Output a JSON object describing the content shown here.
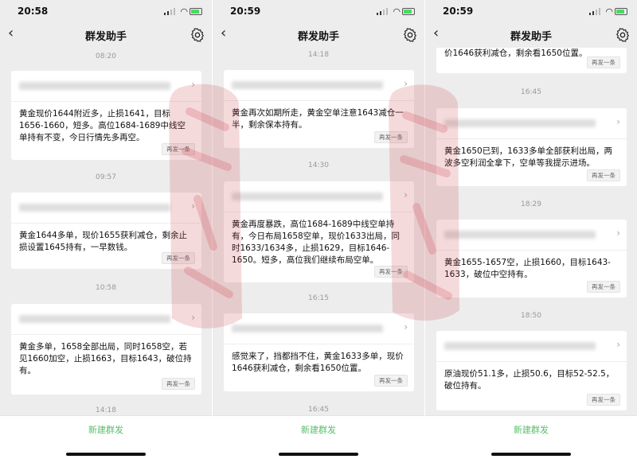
{
  "panels": [
    {
      "time": "20:58",
      "title": "群发助手",
      "new_button": "新建群发",
      "items": [
        {
          "ts": "08:20",
          "message": "黄金现价1644附近多，止损1641，目标1656-1660，短多。高位1684-1689中线空单持有不变，今日行情先多再空。",
          "resend": "再发一条"
        },
        {
          "ts": "09:57",
          "message": "黄金1644多单，现价1655获利减仓，剩余止损设置1645持有，一早数钱。",
          "resend": "再发一条"
        },
        {
          "ts": "10:58",
          "message": "黄金多单，1658全部出局，同时1658空，若见1660加空，止损1663，目标1643，破位持有。",
          "resend": "再发一条"
        },
        {
          "ts": "14:18"
        }
      ]
    },
    {
      "time": "20:59",
      "title": "群发助手",
      "new_button": "新建群发",
      "items": [
        {
          "ts": "14:18",
          "message": "黄金再次如期所走，黄金空单注意1643减仓一半，剩余保本持有。",
          "resend": "再发一条"
        },
        {
          "ts": "14:30",
          "message": "黄金再度暴跌，高位1684-1689中线空单持有，今日布局1658空单，现价1633出局，同时1633/1634多，止损1629，目标1646-1650。短多，高位我们继续布局空单。",
          "resend": "再发一条"
        },
        {
          "ts": "16:15",
          "message": "感觉来了，挡都挡不住，黄金1633多单，现价1646获利减仓，剩余看1650位置。",
          "resend": "再发一条"
        },
        {
          "ts": "16:45"
        }
      ]
    },
    {
      "time": "20:59",
      "title": "群发助手",
      "new_button": "新建群发",
      "items": [
        {
          "message": "价1646获利减仓，剩余看1650位置。",
          "resend": "再发一条"
        },
        {
          "ts": "16:45",
          "message": "黄金1650已到，1633多单全部获利出局，两波多空利润全拿下，空单等我提示进场。",
          "resend": "再发一条"
        },
        {
          "ts": "18:29",
          "message": "黄金1655-1657空，止损1660，目标1643-1633，破位中空持有。",
          "resend": "再发一条"
        },
        {
          "ts": "18:50",
          "message": "原油现价51.1多，止损50.6，目标52-52.5，破位持有。",
          "resend": "再发一条"
        }
      ]
    }
  ],
  "icons": {
    "back": "back-arrow-icon",
    "settings": "gear-icon",
    "chevron": "chevron-right-icon"
  },
  "colors": {
    "accent": "#57be6a",
    "background": "#ededed",
    "watermark": "#c8323c"
  }
}
